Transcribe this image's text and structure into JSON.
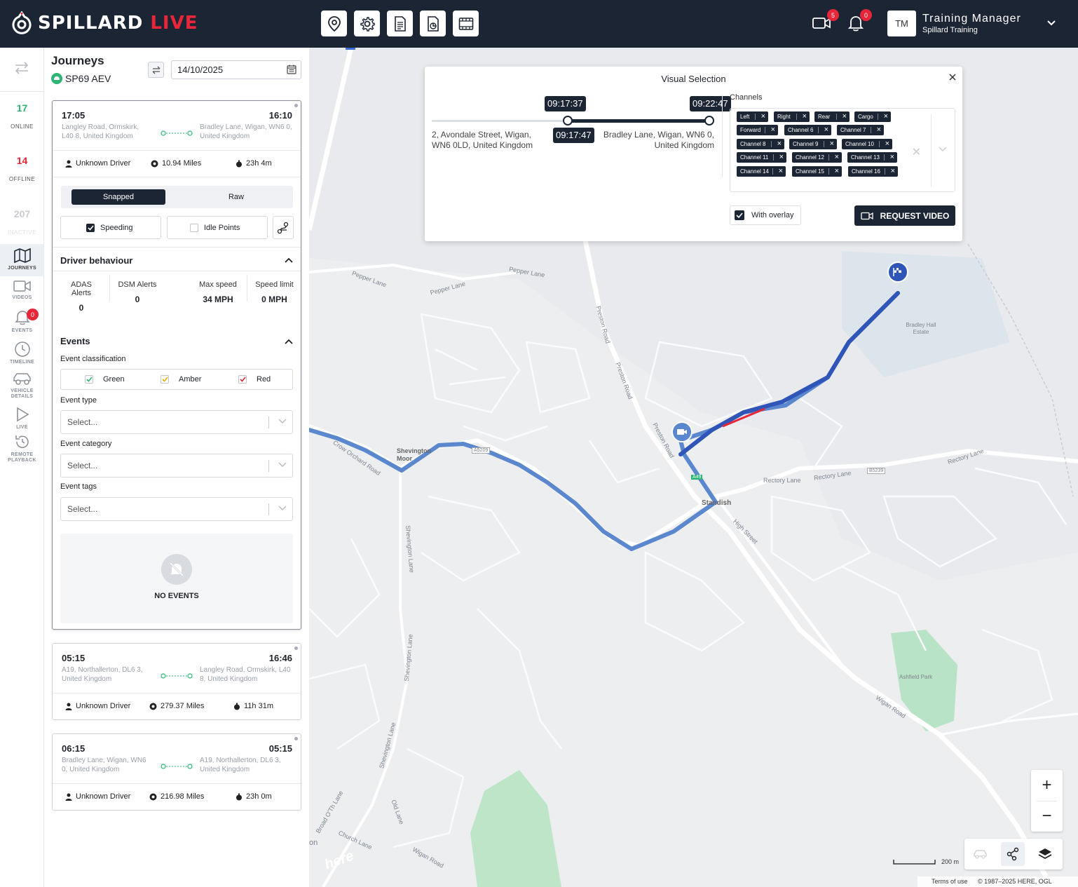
{
  "brand": {
    "name_part1": "SPILLARD",
    "name_part2": "LIVE",
    "accent": "#e8263a",
    "dark": "#1c2533"
  },
  "header": {
    "icons": [
      "map-pin-icon",
      "settings-icon",
      "document-icon",
      "report-icon",
      "film-icon"
    ],
    "video_badge": "5",
    "bell_badge": "0",
    "avatar": "TM",
    "user_name": "Training Manager",
    "user_org": "Spillard Training"
  },
  "nav": {
    "online_count": "17",
    "online_label": "ONLINE",
    "offline_count": "14",
    "offline_label": "OFFLINE",
    "inactive_count": "207",
    "inactive_label": "INACTIVE",
    "journeys": "JOURNEYS",
    "videos": "VIDEOS",
    "events": "EVENTS",
    "events_badge": "0",
    "timeline": "TIMELINE",
    "vehicle_details_1": "VEHICLE",
    "vehicle_details_2": "DETAILS",
    "live": "LIVE",
    "remote_1": "REMOTE",
    "remote_2": "PLAYBACK"
  },
  "panel": {
    "title": "Journeys",
    "vehicle": "SP69 AEV",
    "date": "14/10/2025"
  },
  "journeys": [
    {
      "start": "17:05",
      "end": "16:10",
      "from": "Langley Road, Ormskirk, L40 8, United Kingdom",
      "to": "Bradley Lane, Wigan, WN6 0, United Kingdom",
      "driver": "Unknown Driver",
      "distance": "10.94 Miles",
      "duration": "23h 4m"
    },
    {
      "start": "05:15",
      "end": "16:46",
      "from": "A19, Northallerton, DL6 3, United Kingdom",
      "to": "Langley Road, Ormskirk, L40 8, United Kingdom",
      "driver": "Unknown Driver",
      "distance": "279.37 Miles",
      "duration": "11h 31m"
    },
    {
      "start": "06:15",
      "end": "05:15",
      "from": "Bradley Lane, Wigan, WN6 0, United Kingdom",
      "to": "A19, Northallerton, DL6 3, United Kingdom",
      "driver": "Unknown Driver",
      "distance": "216.98 Miles",
      "duration": "23h 0m"
    }
  ],
  "detail": {
    "snapped": "Snapped",
    "raw": "Raw",
    "speeding": "Speeding",
    "idle_points": "Idle Points",
    "driver_behaviour": "Driver behaviour",
    "adas_label": "ADAS Alerts",
    "adas_value": "0",
    "dsm_label": "DSM Alerts",
    "dsm_value": "0",
    "max_speed_label": "Max speed",
    "max_speed_value": "34 MPH",
    "speed_limit_label": "Speed limit",
    "speed_limit_value": "0 MPH",
    "events_title": "Events",
    "event_classification": "Event classification",
    "green": "Green",
    "amber": "Amber",
    "red": "Red",
    "event_type": "Event type",
    "event_type_placeholder": "Select...",
    "event_category": "Event category",
    "event_category_placeholder": "Select...",
    "event_tags": "Event tags",
    "event_tags_placeholder": "Select...",
    "no_events": "NO EVENTS"
  },
  "visual_selection": {
    "title": "Visual Selection",
    "start_time": "09:17:37",
    "end_time": "09:22:47",
    "current_time": "09:17:47",
    "from_address": "2, Avondale Street, Wigan, WN6 0LD, United Kingdom",
    "to_address": "Bradley Lane, Wigan, WN6 0, United Kingdom",
    "channels_label": "Channels",
    "channels": [
      "Left",
      "Right",
      "Rear",
      "Cargo",
      "Forward",
      "Channel 6",
      "Channel 7",
      "Channel 8",
      "Channel 9",
      "Channel 10",
      "Channel 11",
      "Channel 12",
      "Channel 13",
      "Channel 14",
      "Channel 15",
      "Channel 16"
    ],
    "with_overlay": "With overlay",
    "request_video": "REQUEST VIDEO"
  },
  "map": {
    "labels": {
      "pepper_lane_1": "Pepper Lane",
      "pepper_lane_2": "Pepper Lane",
      "pepper_lane_3": "Pepper Lane",
      "preston_road_1": "Preston Road",
      "preston_road_2": "Preston Road",
      "preston_road_3": "Preston Road",
      "shevington_moor": "Shevington Moor",
      "a5209": "A5209",
      "a49": "A49",
      "b5239": "B5239",
      "standish": "Standish",
      "high_street": "High Street",
      "rectory_lane_1": "Rectory Lane",
      "rectory_lane_2": "Rectory Lane",
      "rectory_lane_3": "Rectory Lane",
      "bradley_hall": "Bradley Hall Estate",
      "crow_orchard": "Crow Orchard Road",
      "shevington_lane_1": "Shevington Lane",
      "shevington_lane_2": "Shevington Lane",
      "shevington_lane_3": "Shevington Lane",
      "ashfield_park": "Ashfield Park",
      "wigan_road_1": "Wigan Road",
      "wigan_road_2": "Wigan Road",
      "broad_o_th_lane": "Broad O'Th Lane",
      "old_lane": "Old Lane",
      "church_lane": "Church Lane",
      "on": "on"
    },
    "scale": "200 m",
    "terms": "Terms of use",
    "copyright": "© 1987–2025 HERE, OGL",
    "here_logo": "here",
    "zoom_in": "+",
    "zoom_out": "−",
    "route_color": "#5b87cf",
    "selection_color": "#2f55b8"
  }
}
